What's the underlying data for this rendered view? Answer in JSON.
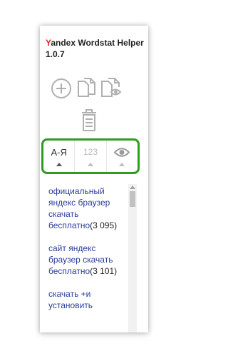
{
  "header": {
    "title_first_letter": "Y",
    "title_rest": "andex Wordstat Helper 1.0.7"
  },
  "toolbar": {
    "icons": [
      "add-icon",
      "copy-icon",
      "view-copy-icon",
      "trash-icon"
    ]
  },
  "sort": {
    "alpha_label": "А-Я",
    "count_label": "123",
    "view_icon": "eye-icon",
    "active": "alpha"
  },
  "phrases": [
    {
      "text": "официальный яндекс браузер скачать бесплатно",
      "count": "(3 095)"
    },
    {
      "text": "сайт яндекс браузер скачать бесплатно",
      "count": "(3 101)"
    },
    {
      "text": "скачать +и установить",
      "count": ""
    }
  ],
  "colors": {
    "accent_green": "#2d9d1c",
    "title_red": "#e52620",
    "link_blue": "#2c3e9a",
    "icon_gray": "#b0b0b0"
  }
}
